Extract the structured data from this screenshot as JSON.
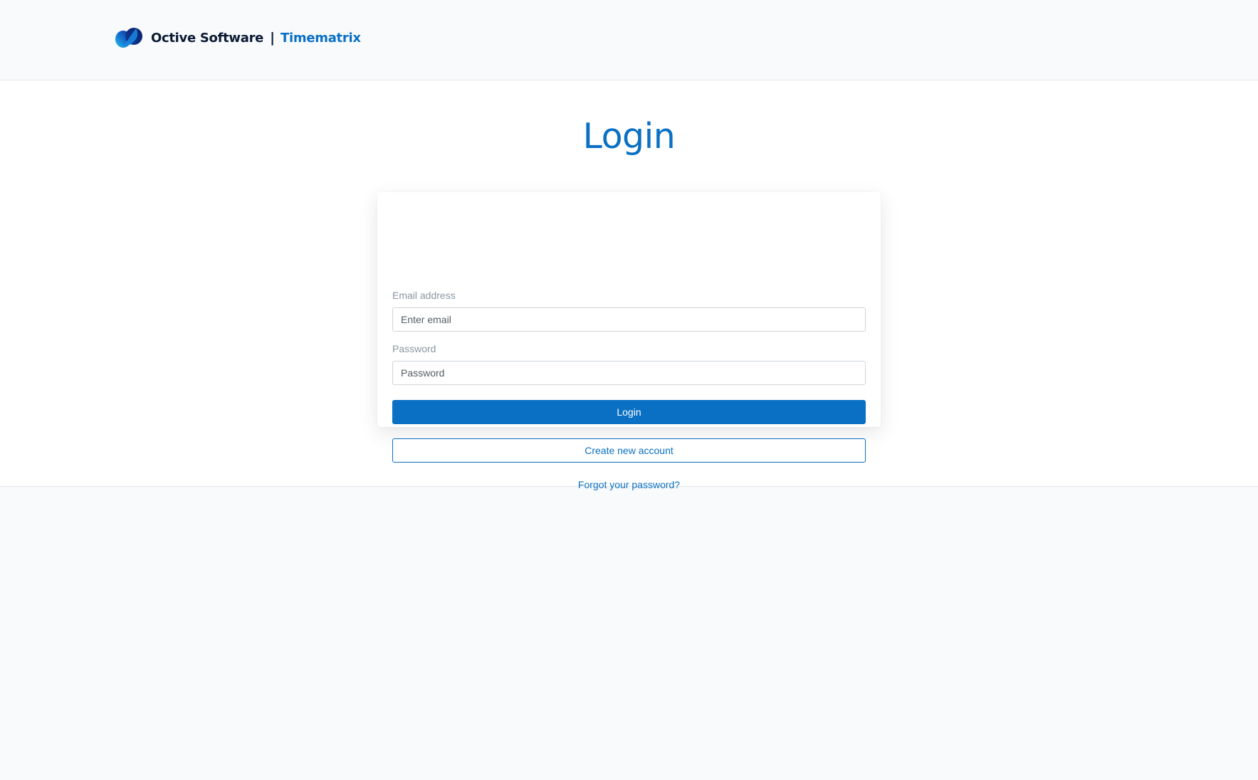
{
  "header": {
    "logo_icon": "octive-logo-icon",
    "company_name": "Octive Software",
    "separator": "|",
    "product_name": "Timematrix"
  },
  "page": {
    "title": "Login"
  },
  "form": {
    "email_label": "Email address",
    "email_placeholder": "Enter email",
    "email_value": "",
    "password_label": "Password",
    "password_placeholder": "Password",
    "password_value": "",
    "login_button": "Login",
    "create_account_button": "Create new account",
    "forgot_password_link": "Forgot your password?"
  },
  "colors": {
    "brand_primary": "#0a70c4",
    "brand_dark": "#0b1a33",
    "background": "#f8fafc",
    "card_background": "#ffffff",
    "label_gray": "#8b96a3"
  }
}
